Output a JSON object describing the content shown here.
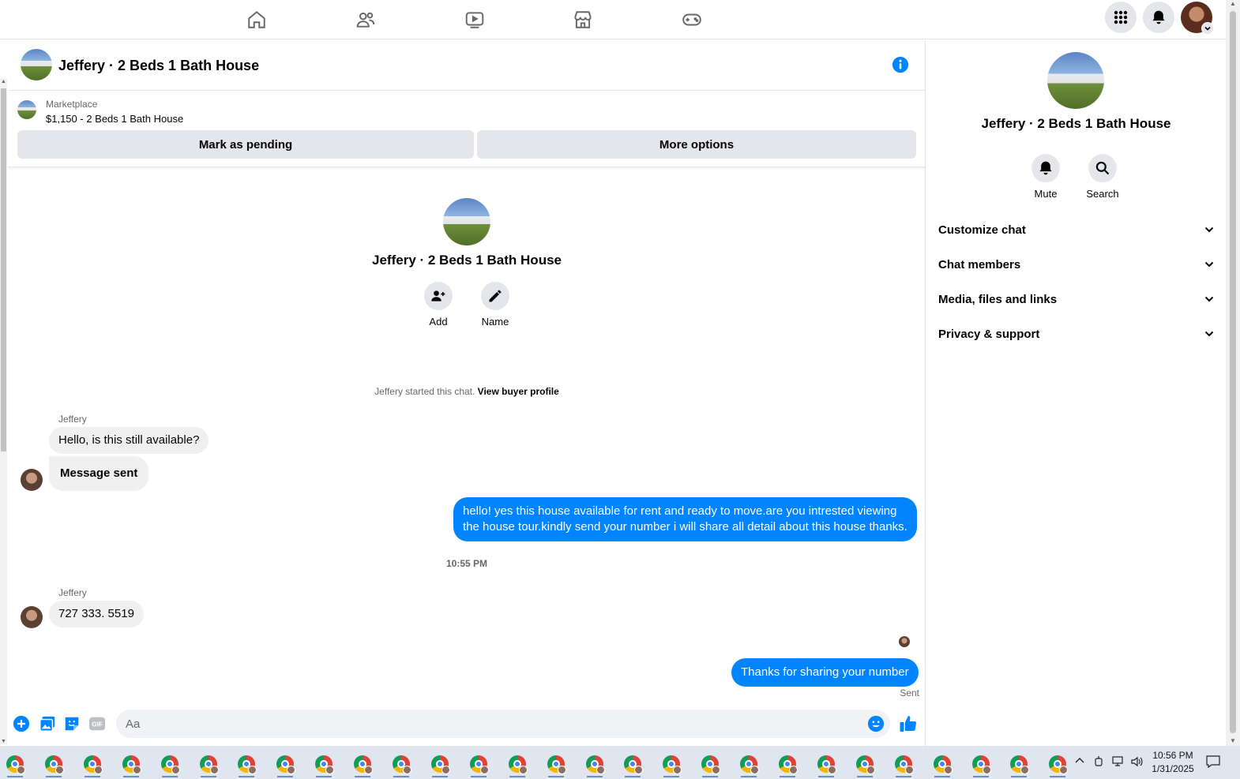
{
  "chat": {
    "title": "Jeffery · 2 Beds 1 Bath House",
    "marketplace_label": "Marketplace",
    "listing": "$1,150 - 2 Beds 1 Bath House",
    "mark_pending_label": "Mark as pending",
    "more_options_label": "More options",
    "intro_name": "Jeffery · 2 Beds 1 Bath House",
    "add_label": "Add",
    "name_label": "Name",
    "started_text": "Jeffery started this chat.",
    "view_profile_label": "View buyer profile",
    "messages": [
      {
        "sender": "Jeffery",
        "text": "Hello, is this still available?"
      },
      {
        "text": "Message sent"
      },
      {
        "text": "hello! yes this house available for rent and ready to move.are you intrested viewing the house tour.kindly send your number i will share all detail about this house thanks."
      },
      {
        "timestamp": "10:55 PM"
      },
      {
        "sender": "Jeffery",
        "text": "727 333. 5519"
      },
      {
        "text": "Thanks for sharing your number",
        "status": "Sent"
      }
    ],
    "composer_placeholder": "Aa"
  },
  "sidebar": {
    "name": "Jeffery · 2 Beds 1 Bath House",
    "mute_label": "Mute",
    "search_label": "Search",
    "sections": [
      "Customize chat",
      "Chat members",
      "Media, files and links",
      "Privacy & support"
    ]
  },
  "taskbar": {
    "time": "10:56 PM",
    "date": "1/31/2025"
  },
  "colors": {
    "accent": "#0084ff",
    "bubble_in": "#f0f0f0",
    "button_bg": "#e4e6eb"
  },
  "icons": {
    "top_nav": [
      "home-icon",
      "friends-icon",
      "video-icon",
      "marketplace-icon",
      "gaming-icon"
    ],
    "top_right": [
      "menu-grid-icon",
      "bell-icon",
      "avatar"
    ],
    "composer": [
      "plus-icon",
      "photo-icon",
      "sticker-icon",
      "gif-icon",
      "emoji-icon",
      "like-icon"
    ]
  }
}
